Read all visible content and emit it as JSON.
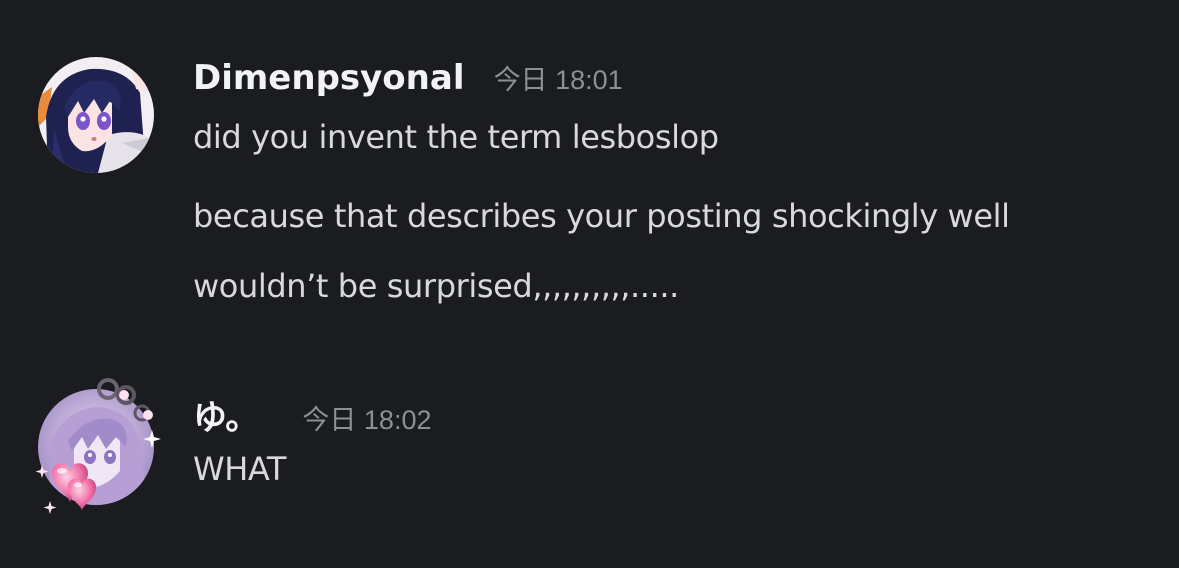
{
  "messages": [
    {
      "username": "Dimenpsyonal",
      "timestamp": "今日 18:01",
      "avatar_icon": "anime-girl-purple-hair-avatar",
      "lines": [
        "did you invent the term lesboslop",
        "because that describes your posting shockingly well",
        "wouldn’t be surprised,,,,,,,,,,....."
      ]
    },
    {
      "username": "ゆ。",
      "timestamp": "今日 18:02",
      "avatar_icon": "anime-girl-lavender-avatar-with-heart-decoration",
      "lines": [
        "WHAT"
      ]
    }
  ],
  "colors": {
    "background": "#1b1c20",
    "username": "#f2f3f5",
    "timestamp": "#8d8f97",
    "message_text": "#d8d9dd"
  }
}
